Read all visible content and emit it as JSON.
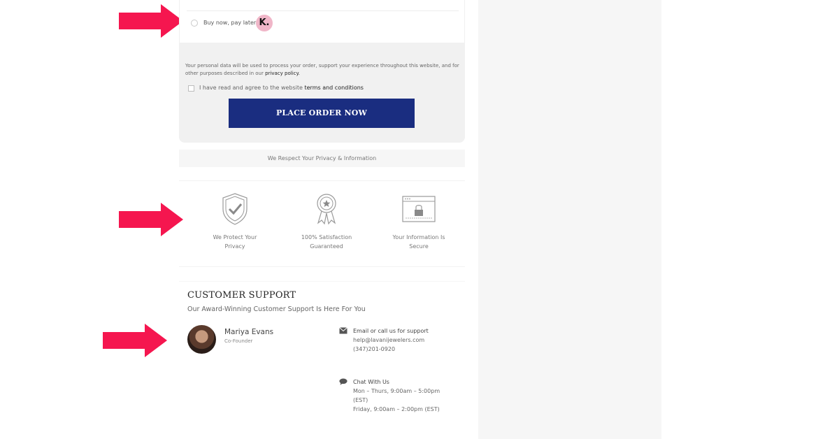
{
  "payment": {
    "option_label": "Buy now, pay later",
    "klarna_logo": "K."
  },
  "terms": {
    "privacy_notice_prefix": "Your personal data will be used to process your order, support your experience throughout this website, and for other purposes described in our ",
    "privacy_link": "privacy policy.",
    "agree_prefix": "I have read and agree to the website ",
    "agree_link": "terms and conditions",
    "place_order_label": "PLACE ORDER NOW"
  },
  "privacy_strip": "We Respect Your Privacy & Information",
  "badges": [
    {
      "icon": "shield-check-icon",
      "line1": "We Protect Your",
      "line2": "Privacy"
    },
    {
      "icon": "award-ribbon-icon",
      "line1": "100% Satisfaction",
      "line2": "Guaranteed"
    },
    {
      "icon": "secure-browser-lock-icon",
      "line1": "Your Information Is",
      "line2": "Secure"
    }
  ],
  "support": {
    "title": "CUSTOMER SUPPORT",
    "subtitle": "Our Award-Winning Customer Support Is Here For You",
    "person": {
      "name": "Mariya Evans",
      "role": "Co-Founder"
    },
    "email_block": {
      "heading": "Email or call us for support",
      "email": "help@lavanijewelers.com",
      "phone": "(347)201-0920"
    },
    "chat_block": {
      "heading": "Chat With Us",
      "line1": "Mon – Thurs, 9:00am – 5:00pm",
      "line2": "(EST)",
      "line3": "Friday, 9:00am – 2:00pm (EST)"
    }
  },
  "colors": {
    "accent_button": "#1a2d80",
    "arrow": "#f5164f",
    "klarna_pink": "#f0b6c8"
  }
}
